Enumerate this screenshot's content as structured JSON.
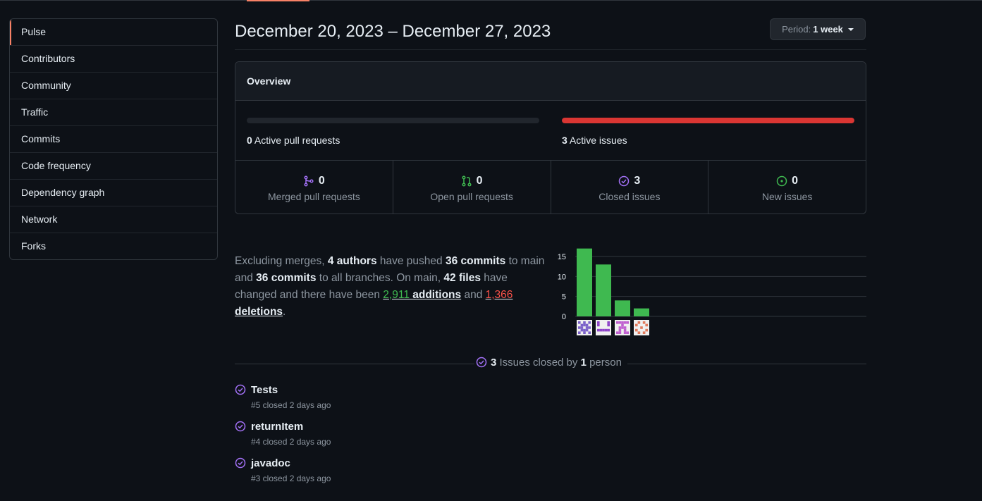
{
  "sidebar": {
    "items": [
      {
        "label": "Pulse"
      },
      {
        "label": "Contributors"
      },
      {
        "label": "Community"
      },
      {
        "label": "Traffic"
      },
      {
        "label": "Commits"
      },
      {
        "label": "Code frequency"
      },
      {
        "label": "Dependency graph"
      },
      {
        "label": "Network"
      },
      {
        "label": "Forks"
      }
    ]
  },
  "header": {
    "date_range": "December 20, 2023 – December 27, 2023",
    "period_label": "Period:",
    "period_value": "1 week"
  },
  "overview": {
    "title": "Overview",
    "pull_requests": {
      "count": "0",
      "label": "Active pull requests",
      "fill": 0
    },
    "issues": {
      "count": "3",
      "label": "Active issues",
      "fill": 1
    },
    "stats": [
      {
        "count": "0",
        "label": "Merged pull requests",
        "icon": "merge-icon"
      },
      {
        "count": "0",
        "label": "Open pull requests",
        "icon": "pull-request-icon"
      },
      {
        "count": "3",
        "label": "Closed issues",
        "icon": "issue-closed-icon"
      },
      {
        "count": "0",
        "label": "New issues",
        "icon": "issue-opened-icon"
      }
    ]
  },
  "summary": {
    "t1": "Excluding merges, ",
    "authors": "4 authors",
    "t2": " have pushed ",
    "commits_main": "36 commits",
    "t3": " to main and ",
    "commits_all": "36 commits",
    "t4": " to all branches. On main, ",
    "files": "42 files",
    "t5": " have changed and there have been ",
    "additions_num": "2,911",
    "additions_word": " additions",
    "t6": " and ",
    "deletions_num": "1,366",
    "deletions_word": " deletions",
    "t7": "."
  },
  "chart_data": {
    "type": "bar",
    "categories": [
      "author-1",
      "author-2",
      "author-3",
      "author-4"
    ],
    "values": [
      17,
      13,
      4,
      2
    ],
    "ylim": [
      0,
      18
    ],
    "yticks": [
      0,
      5,
      10,
      15
    ],
    "bar_color": "#3fb950",
    "grid": true
  },
  "issues_closed": {
    "count": "3",
    "t1": " Issues closed by ",
    "people": "1",
    "t2": " person",
    "items": [
      {
        "title": "Tests",
        "meta": "#5 closed 2 days ago"
      },
      {
        "title": "returnItem",
        "meta": "#4 closed 2 days ago"
      },
      {
        "title": "javadoc",
        "meta": "#3 closed 2 days ago"
      }
    ]
  },
  "colors": {
    "accent": "#f78166",
    "issues_bar": "#da3633",
    "closed_purple": "#a371f7",
    "open_green": "#3fb950"
  }
}
